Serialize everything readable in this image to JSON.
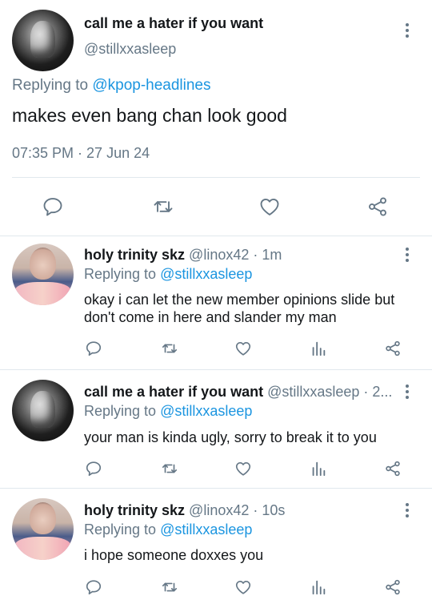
{
  "main_tweet": {
    "display_name": "call me a hater if you want",
    "handle": "@stillxxasleep",
    "replying_prefix": "Replying to",
    "replying_to": "@kpop-headlines",
    "text": "makes even bang chan look good",
    "timestamp": "07:35 PM · 27 Jun 24",
    "actions": [
      "reply-icon",
      "retweet-icon",
      "like-icon",
      "share-icon"
    ]
  },
  "replies": [
    {
      "display_name": "holy trinity skz",
      "meta": "@linox42 · 1m",
      "replying_prefix": "Replying to",
      "replying_to": "@stillxxasleep",
      "text": "okay i can let the new member opinions slide but don't come in here and slander my man"
    },
    {
      "display_name": "call me a hater if you want",
      "meta": "@stillxxasleep · 2...",
      "replying_prefix": "Replying to",
      "replying_to": "@stillxxasleep",
      "text": "your man is kinda ugly, sorry to break it to you"
    },
    {
      "display_name": "holy trinity skz",
      "meta": "@linox42 · 10s",
      "replying_prefix": "Replying to",
      "replying_to": "@stillxxasleep",
      "text": "i hope someone doxxes you"
    }
  ],
  "colors": {
    "link": "#1b95e0",
    "secondary_text": "#657786",
    "primary_text": "#14171a",
    "icon": "#657786",
    "divider": "#e1e8ed"
  }
}
